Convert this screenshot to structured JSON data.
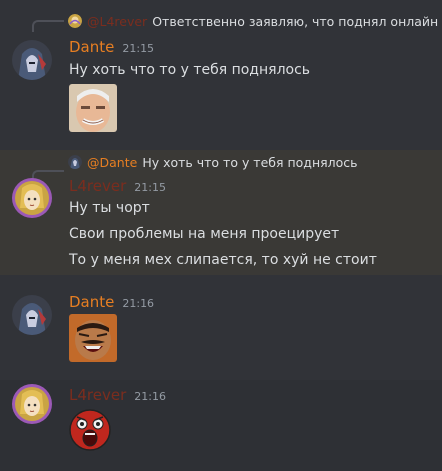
{
  "colors": {
    "background": "#313338",
    "message_hover": "#2e3035",
    "mention_highlight": "#3a3936",
    "dante_name": "#e67e22",
    "l4rever_name": "#7b2d1e",
    "timestamp": "#949ba4",
    "text": "#dbdee1"
  },
  "messages": [
    {
      "reply": {
        "author": "@L4rever",
        "text": "Ответственно заявляю, что поднял онлайн"
      },
      "author": "Dante",
      "time": "21:15",
      "lines": [
        "Ну хоть что то у тебя поднялось"
      ],
      "attachment": "harold-meme-image"
    },
    {
      "reply": {
        "author": "@Dante",
        "text": "Ну хоть что то у тебя поднялось"
      },
      "author": "L4rever",
      "time": "21:15",
      "lines": [
        "Ну ты чорт",
        "Свои проблемы на меня проецирует",
        "То у меня мех слипается, то хуй не стоит"
      ]
    },
    {
      "author": "Dante",
      "time": "21:16",
      "attachment": "laughing-man-image"
    },
    {
      "author": "L4rever",
      "time": "21:16",
      "attachment": "red-face-sticker"
    }
  ]
}
